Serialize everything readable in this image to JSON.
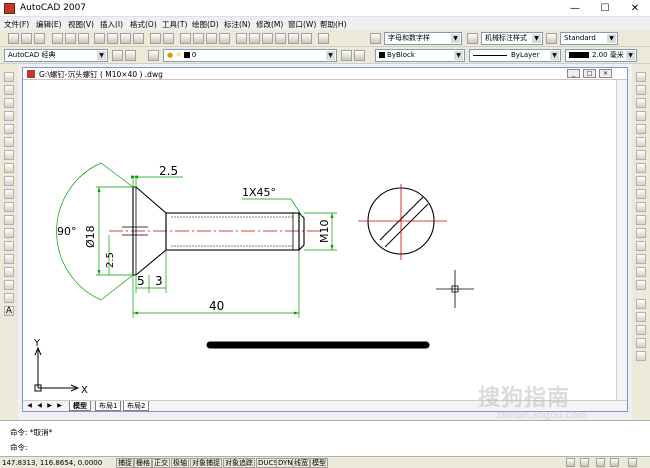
{
  "window": {
    "title": "AutoCAD 2007",
    "minimize": "—",
    "maximize": "☐",
    "close": "✕"
  },
  "menu": [
    "文件(F)",
    "编辑(E)",
    "视图(V)",
    "插入(I)",
    "格式(O)",
    "工具(T)",
    "绘图(D)",
    "标注(N)",
    "修改(M)",
    "窗口(W)",
    "帮助(H)"
  ],
  "toolbar": {
    "text_style": "字母和数字样",
    "dim_style": "机械标注样式",
    "table_style": "Standard",
    "workspace": "AutoCAD 经典",
    "layer": "0",
    "color": "ByBlock",
    "linetype": "ByLayer",
    "lineweight": "2.00 毫米"
  },
  "drawing": {
    "title": "G:\\螺钉-沉头螺钉 ( M10×40 ) .dwg",
    "dims": {
      "top": "2.5",
      "chamfer": "1X45°",
      "angle": "90°",
      "dia": "Ø18",
      "thread": "M10",
      "head": "2.5",
      "d5": "5",
      "d3": "3",
      "len": "40"
    },
    "ucs": {
      "y": "Y",
      "x": "X"
    }
  },
  "tabs": [
    "模型",
    "布局1",
    "布局2"
  ],
  "command": {
    "line1": "命令: *取消*",
    "line2": "命令:"
  },
  "status": {
    "coords": "147.8313, 116.8654, 0.0000",
    "buttons": [
      "捕捉",
      "栅格",
      "正交",
      "极轴",
      "对象捕捉",
      "对象追踪",
      "DUCS",
      "DYN",
      "线宽",
      "模型"
    ]
  },
  "watermark": {
    "text": "搜狗指南",
    "sub": "zhinan.sogou.com"
  },
  "colors": {
    "accent_red": "#d00000",
    "geometry": "#000000",
    "dimension": "#00a000"
  }
}
